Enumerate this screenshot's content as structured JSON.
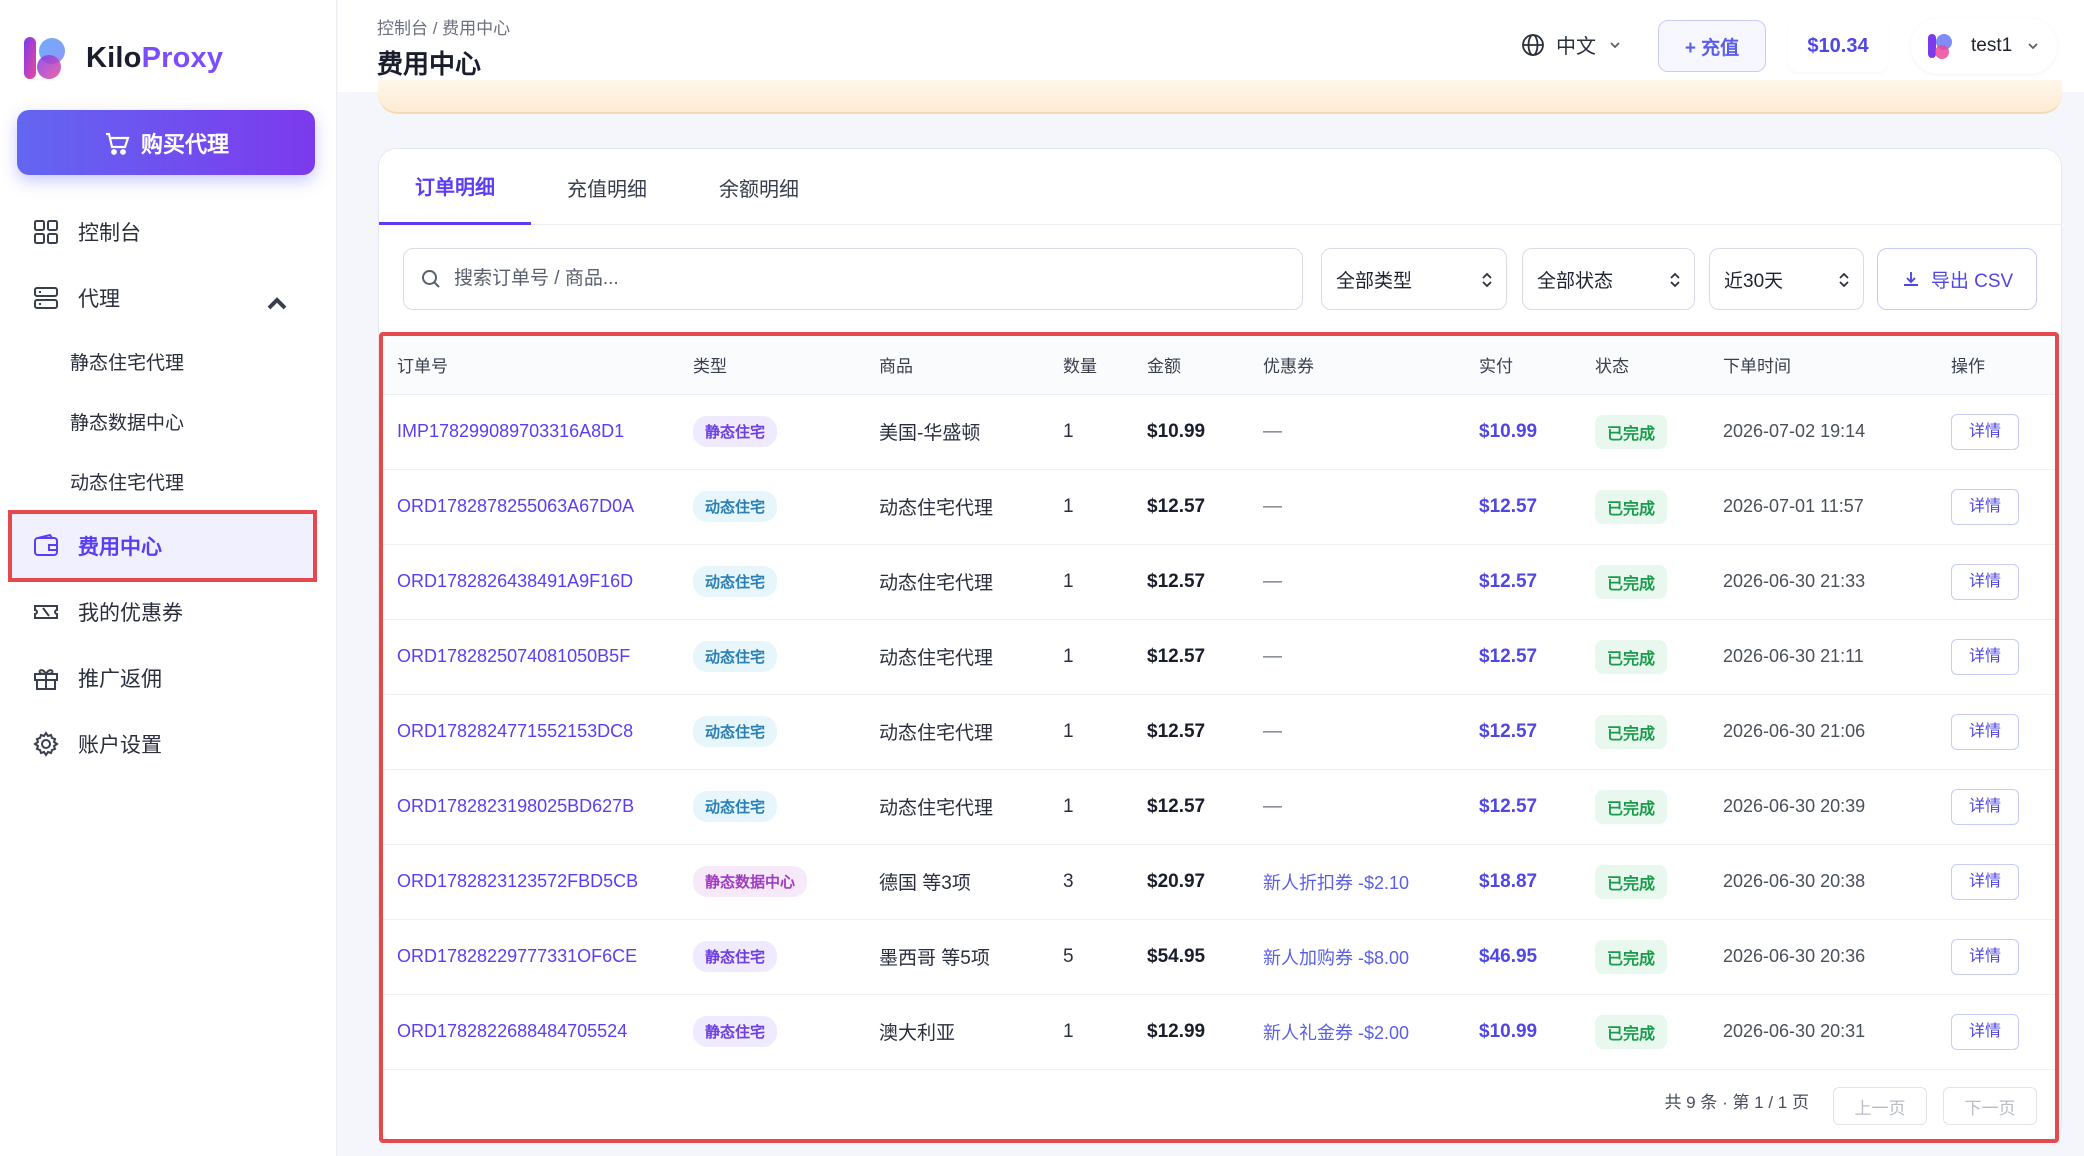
{
  "brand": {
    "name_part1": "Kilo",
    "name_part2": "Proxy"
  },
  "sidebar": {
    "buy_label": "购买代理",
    "items": [
      {
        "label": "控制台"
      },
      {
        "label": "代理"
      },
      {
        "label": "静态住宅代理"
      },
      {
        "label": "静态数据中心"
      },
      {
        "label": "动态住宅代理"
      },
      {
        "label": "费用中心"
      },
      {
        "label": "我的优惠券"
      },
      {
        "label": "推广返佣"
      },
      {
        "label": "账户设置"
      }
    ]
  },
  "header": {
    "breadcrumb": "控制台  /  费用中心",
    "title": "费用中心",
    "language": "中文",
    "recharge_label": "+ 充值",
    "balance": "$10.34",
    "username": "test1"
  },
  "tabs": [
    "订单明细",
    "充值明细",
    "余额明细"
  ],
  "filters": {
    "search_placeholder": "搜索订单号 / 商品...",
    "type": "全部类型",
    "status": "全部状态",
    "range": "近30天",
    "export_label": "导出 CSV"
  },
  "table": {
    "headers": [
      "订单号",
      "类型",
      "商品",
      "数量",
      "金额",
      "优惠券",
      "实付",
      "状态",
      "下单时间",
      "操作"
    ],
    "rows": [
      {
        "id": "IMP178299089703316A8D1",
        "type": "静态住宅",
        "type_kind": "static",
        "product": "美国-华盛顿",
        "qty": "1",
        "amount": "$10.99",
        "coupon": "—",
        "paid": "$10.99",
        "status": "已完成",
        "time": "2026-07-02 19:14",
        "action": "详情"
      },
      {
        "id": "ORD1782878255063A67D0A",
        "type": "动态住宅",
        "type_kind": "dynamic",
        "product": "动态住宅代理",
        "qty": "1",
        "amount": "$12.57",
        "coupon": "—",
        "paid": "$12.57",
        "status": "已完成",
        "time": "2026-07-01 11:57",
        "action": "详情"
      },
      {
        "id": "ORD1782826438491A9F16D",
        "type": "动态住宅",
        "type_kind": "dynamic",
        "product": "动态住宅代理",
        "qty": "1",
        "amount": "$12.57",
        "coupon": "—",
        "paid": "$12.57",
        "status": "已完成",
        "time": "2026-06-30 21:33",
        "action": "详情"
      },
      {
        "id": "ORD1782825074081050B5F",
        "type": "动态住宅",
        "type_kind": "dynamic",
        "product": "动态住宅代理",
        "qty": "1",
        "amount": "$12.57",
        "coupon": "—",
        "paid": "$12.57",
        "status": "已完成",
        "time": "2026-06-30 21:11",
        "action": "详情"
      },
      {
        "id": "ORD1782824771552153DC8",
        "type": "动态住宅",
        "type_kind": "dynamic",
        "product": "动态住宅代理",
        "qty": "1",
        "amount": "$12.57",
        "coupon": "—",
        "paid": "$12.57",
        "status": "已完成",
        "time": "2026-06-30 21:06",
        "action": "详情"
      },
      {
        "id": "ORD1782823198025BD627B",
        "type": "动态住宅",
        "type_kind": "dynamic",
        "product": "动态住宅代理",
        "qty": "1",
        "amount": "$12.57",
        "coupon": "—",
        "paid": "$12.57",
        "status": "已完成",
        "time": "2026-06-30 20:39",
        "action": "详情"
      },
      {
        "id": "ORD1782823123572FBD5CB",
        "type": "静态数据中心",
        "type_kind": "dc",
        "product": "德国 等3项",
        "qty": "3",
        "amount": "$20.97",
        "coupon": "新人折扣券 -$2.10",
        "paid": "$18.87",
        "status": "已完成",
        "time": "2026-06-30 20:38",
        "action": "详情"
      },
      {
        "id": "ORD17828229777331OF6CE",
        "type": "静态住宅",
        "type_kind": "static",
        "product": "墨西哥 等5项",
        "qty": "5",
        "amount": "$54.95",
        "coupon": "新人加购券 -$8.00",
        "paid": "$46.95",
        "status": "已完成",
        "time": "2026-06-30 20:36",
        "action": "详情"
      },
      {
        "id": "ORD1782822688484705524",
        "type": "静态住宅",
        "type_kind": "static",
        "product": "澳大利亚",
        "qty": "1",
        "amount": "$12.99",
        "coupon": "新人礼金券 -$2.00",
        "paid": "$10.99",
        "status": "已完成",
        "time": "2026-06-30 20:31",
        "action": "详情"
      }
    ]
  },
  "pagination": {
    "info": "共 9 条 · 第 1 / 1 页",
    "prev": "上一页",
    "next": "下一页"
  },
  "colors": {
    "accent": "#5b3df5",
    "highlight_border": "#e5484d",
    "success": "#1a9b4b"
  }
}
